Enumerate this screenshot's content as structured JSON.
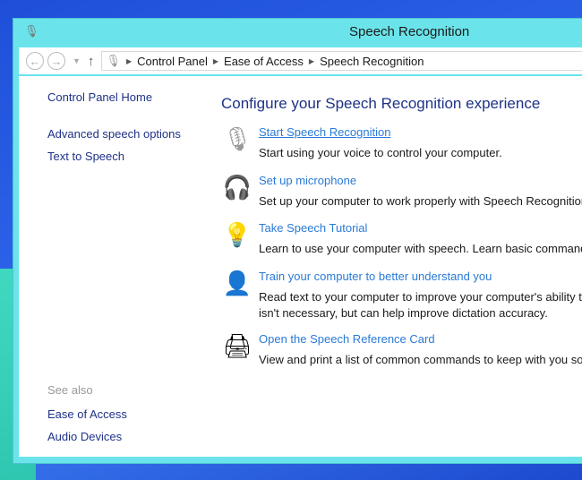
{
  "window": {
    "title": "Speech Recognition"
  },
  "address": {
    "crumbs": [
      "Control Panel",
      "Ease of Access",
      "Speech Recognition"
    ]
  },
  "left": {
    "home": "Control Panel Home",
    "links": [
      "Advanced speech options",
      "Text to Speech"
    ],
    "see_also": "See also",
    "see_also_links": [
      "Ease of Access",
      "Audio Devices"
    ]
  },
  "main": {
    "heading": "Configure your Speech Recognition experience",
    "tasks": [
      {
        "icon": "microphone-icon",
        "link": "Start Speech Recognition",
        "desc": "Start using your voice to control your computer."
      },
      {
        "icon": "headset-icon",
        "link": "Set up microphone",
        "desc": "Set up your computer to work properly with Speech Recognition."
      },
      {
        "icon": "lightbulb-icon",
        "link": "Take Speech Tutorial",
        "desc": "Learn to use your computer with speech.  Learn basic commands and"
      },
      {
        "icon": "user-icon",
        "link": "Train your computer to better understand you",
        "desc": "Read text to your computer to improve your computer's ability to un",
        "desc2": "isn't necessary, but can help improve dictation accuracy."
      },
      {
        "icon": "printer-icon",
        "link": "Open the Speech Reference Card",
        "desc": "View and print a list of common commands to keep with you so you"
      }
    ]
  }
}
